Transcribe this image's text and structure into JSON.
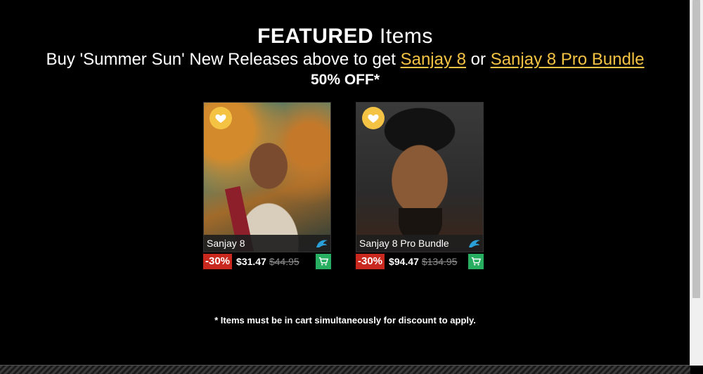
{
  "header": {
    "title_bold": "FEATURED",
    "title_light": "Items",
    "subtitle_prefix": "Buy 'Summer Sun' New Releases above to get",
    "link1": "Sanjay 8",
    "subtitle_or": "or",
    "link2": "Sanjay 8 Pro Bundle",
    "discount": "50% OFF*"
  },
  "products": [
    {
      "name": "Sanjay 8",
      "discount_badge": "-30%",
      "price": "$31.47",
      "original_price": "$44.95"
    },
    {
      "name": "Sanjay 8 Pro Bundle",
      "discount_badge": "-30%",
      "price": "$94.47",
      "original_price": "$134.95"
    }
  ],
  "footnote": "* Items must be in cart simultaneously for discount to apply.",
  "colors": {
    "accent_gold": "#f5c343",
    "badge_red": "#c8281e",
    "cart_green": "#27ae60"
  },
  "icons": {
    "favorite": "heart-icon",
    "publisher": "dragon-logo-icon",
    "cart": "cart-icon"
  }
}
